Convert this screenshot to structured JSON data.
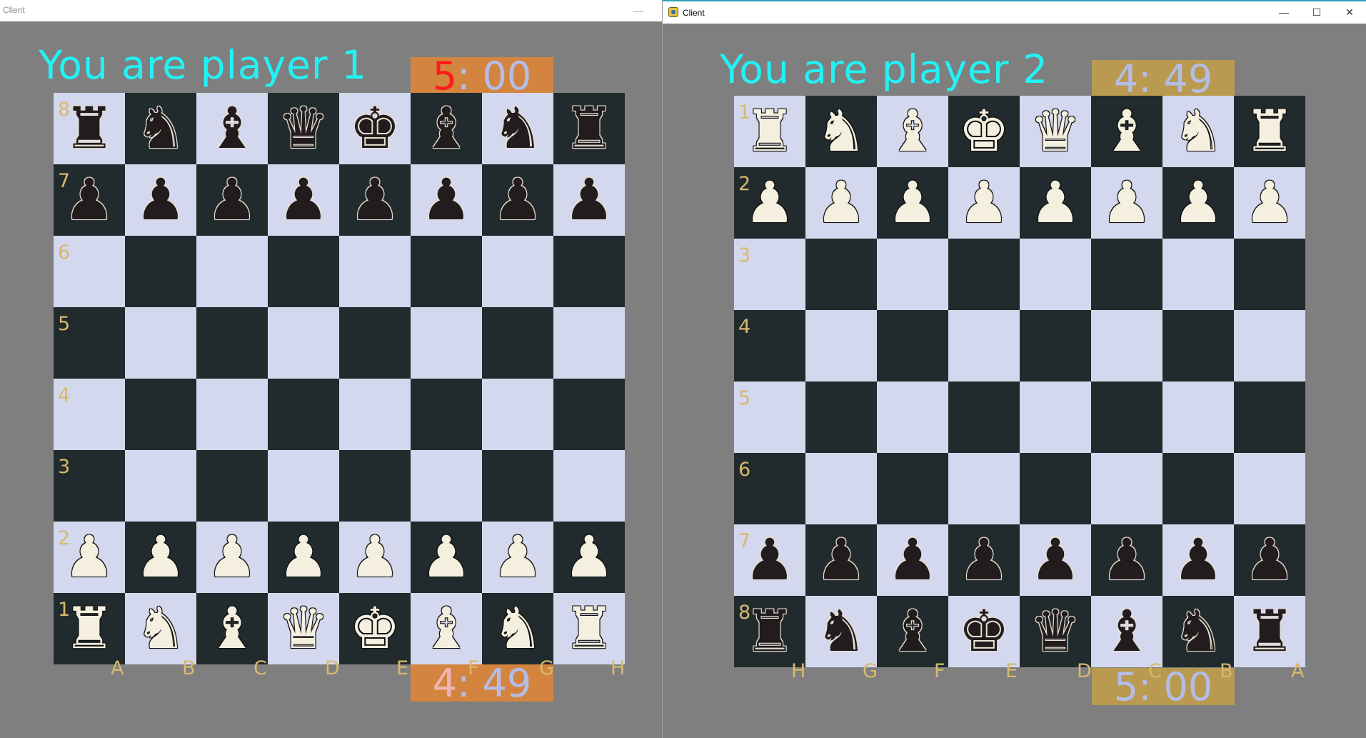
{
  "windows": [
    {
      "title": "Client",
      "player_label": "You are player 1",
      "timer_top": {
        "minutes": "5",
        "rest": ": 00"
      },
      "timer_bottom": {
        "minutes": "4",
        "rest": ": 49"
      },
      "rank_labels": [
        "8",
        "7",
        "6",
        "5",
        "4",
        "3",
        "2",
        "1"
      ],
      "file_labels": [
        "A",
        "B",
        "C",
        "D",
        "E",
        "F",
        "G",
        "H"
      ],
      "board": [
        [
          "bR",
          "bN",
          "bB",
          "bQ",
          "bK",
          "bB",
          "bN",
          "bR"
        ],
        [
          "bP",
          "bP",
          "bP",
          "bP",
          "bP",
          "bP",
          "bP",
          "bP"
        ],
        [
          "",
          "",
          "",
          "",
          "",
          "",
          "",
          ""
        ],
        [
          "",
          "",
          "",
          "",
          "",
          "",
          "",
          ""
        ],
        [
          "",
          "",
          "",
          "",
          "",
          "",
          "",
          ""
        ],
        [
          "",
          "",
          "",
          "",
          "",
          "",
          "",
          ""
        ],
        [
          "wP",
          "wP",
          "wP",
          "wP",
          "wP",
          "wP",
          "wP",
          "wP"
        ],
        [
          "wR",
          "wN",
          "wB",
          "wQ",
          "wK",
          "wB",
          "wN",
          "wR"
        ]
      ]
    },
    {
      "title": "Client",
      "player_label": "You are player 2",
      "timer_top": {
        "minutes": "4",
        "rest": ": 49"
      },
      "timer_bottom": {
        "minutes": "5",
        "rest": ": 00"
      },
      "rank_labels": [
        "1",
        "2",
        "3",
        "4",
        "5",
        "6",
        "7",
        "8"
      ],
      "file_labels": [
        "H",
        "G",
        "F",
        "E",
        "D",
        "C",
        "B",
        "A"
      ],
      "board": [
        [
          "wR",
          "wN",
          "wB",
          "wK",
          "wQ",
          "wB",
          "wN",
          "wR"
        ],
        [
          "wP",
          "wP",
          "wP",
          "wP",
          "wP",
          "wP",
          "wP",
          "wP"
        ],
        [
          "",
          "",
          "",
          "",
          "",
          "",
          "",
          ""
        ],
        [
          "",
          "",
          "",
          "",
          "",
          "",
          "",
          ""
        ],
        [
          "",
          "",
          "",
          "",
          "",
          "",
          "",
          ""
        ],
        [
          "",
          "",
          "",
          "",
          "",
          "",
          "",
          ""
        ],
        [
          "bP",
          "bP",
          "bP",
          "bP",
          "bP",
          "bP",
          "bP",
          "bP"
        ],
        [
          "bR",
          "bN",
          "bB",
          "bK",
          "bQ",
          "bB",
          "bN",
          "bR"
        ]
      ]
    }
  ],
  "piece_glyphs": {
    "K": "♚",
    "Q": "♛",
    "R": "♜",
    "B": "♝",
    "N": "♞",
    "P": "♟"
  },
  "colors": {
    "light_square": "#d4d8ee",
    "dark_square": "#212b2d",
    "player_label": "#22f2f5",
    "timer_bg_window1": "#d38540",
    "timer_bg_window2": "#b99a4f",
    "timer_active_digit": "#ff1a1a",
    "coordinate_label": "#d7b96e",
    "background": "#7f7f7f"
  },
  "window_controls": {
    "minimize": "—",
    "maximize": "☐",
    "close": "✕"
  }
}
